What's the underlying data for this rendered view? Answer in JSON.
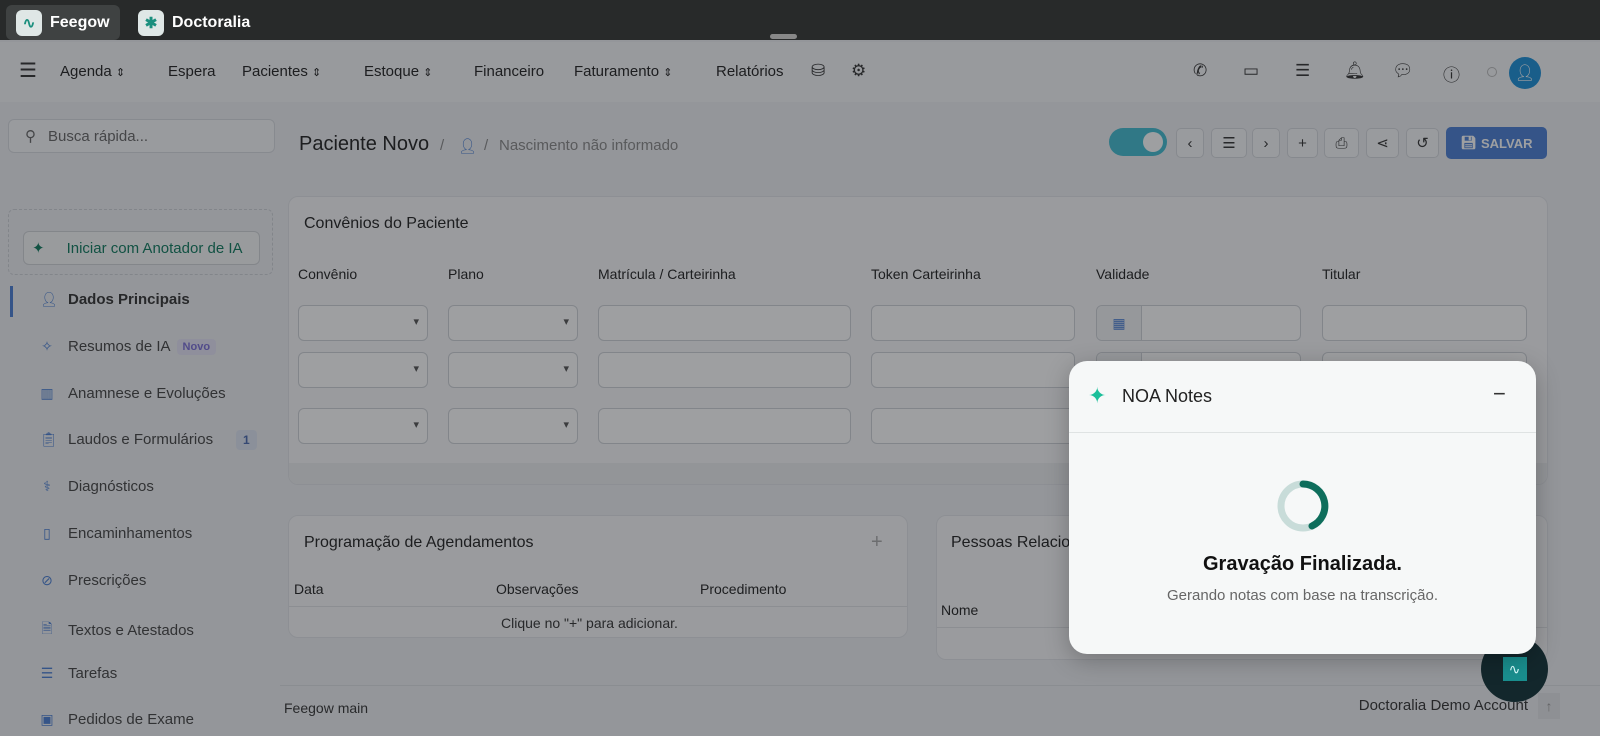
{
  "apps": [
    {
      "label": "Feegow",
      "logo": "feegow-logo"
    },
    {
      "label": "Doctoralia",
      "logo": "doctoralia-logo"
    }
  ],
  "nav": {
    "items": [
      "Agenda",
      "Espera",
      "Pacientes",
      "Estoque",
      "Financeiro",
      "Faturamento",
      "Relatórios"
    ]
  },
  "search": {
    "placeholder": "Busca rápida..."
  },
  "header": {
    "title": "Paciente Novo",
    "birth": "Nascimento não informado",
    "save": "SALVAR"
  },
  "sidebar": {
    "ai_button": "Iniciar com Anotador de IA",
    "items": [
      {
        "label": "Dados Principais",
        "icon": "user-icon"
      },
      {
        "label": "Resumos de IA",
        "icon": "sparkles-icon",
        "badge": "Novo"
      },
      {
        "label": "Anamnese e Evoluções",
        "icon": "chart-icon"
      },
      {
        "label": "Laudos e Formulários",
        "icon": "clipboard-icon",
        "badge": "1"
      },
      {
        "label": "Diagnósticos",
        "icon": "stethoscope-icon"
      },
      {
        "label": "Encaminhamentos",
        "icon": "file-icon"
      },
      {
        "label": "Prescrições",
        "icon": "pill-icon"
      },
      {
        "label": "Textos e Atestados",
        "icon": "document-icon"
      },
      {
        "label": "Tarefas",
        "icon": "tasks-icon"
      },
      {
        "label": "Pedidos de Exame",
        "icon": "exam-icon"
      }
    ]
  },
  "convenios": {
    "title": "Convênios do Paciente",
    "columns": [
      "Convênio",
      "Plano",
      "Matrícula / Carteirinha",
      "Token Carteirinha",
      "Validade",
      "Titular"
    ]
  },
  "agendamentos": {
    "title": "Programação de Agendamentos",
    "columns": [
      "Data",
      "Observações",
      "Procedimento"
    ],
    "empty": "Clique no \"+\" para adicionar."
  },
  "pessoas": {
    "title": "Pessoas Relacionadas",
    "columns": [
      "Nome"
    ]
  },
  "footer": {
    "left": "Feegow main",
    "right": "Doctoralia Demo Account"
  },
  "modal": {
    "title": "NOA Notes",
    "heading": "Gravação Finalizada.",
    "subtitle": "Gerando notas com base na transcrição.",
    "accent": "#0e6e5c"
  }
}
